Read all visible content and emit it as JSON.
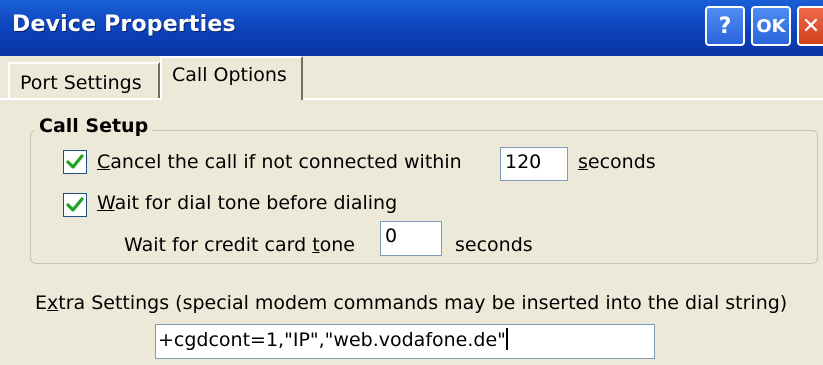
{
  "window": {
    "title": "Device Properties",
    "buttons": {
      "help": "?",
      "ok": "OK",
      "close": "✕"
    }
  },
  "tabs": [
    {
      "label": "Port Settings",
      "selected": false
    },
    {
      "label": "Call Options",
      "selected": true
    }
  ],
  "call_setup": {
    "title": "Call Setup",
    "cancel_call": {
      "checked": true,
      "label_accel": "C",
      "label_rest": "ancel the call if not connected within",
      "value": "120",
      "unit_accel": "s",
      "unit_rest": "econds"
    },
    "wait_dial_tone": {
      "checked": true,
      "label_accel": "W",
      "label_rest": "ait for dial tone before dialing"
    },
    "credit_card": {
      "label_pre": "Wait for credit card ",
      "label_accel": "t",
      "label_post": "one",
      "value": "0",
      "unit": "seconds"
    }
  },
  "extra_settings": {
    "label_pre": "E",
    "label_accel": "x",
    "label_post": "tra Settings (special modem commands may be inserted into the dial string)",
    "value": "+cgdcont=1,\"IP\",\"web.vodafone.de\""
  },
  "colors": {
    "titlebar": "#0b3fb8",
    "dialog_bg": "#ece9d8",
    "checkmark": "#21a121"
  }
}
